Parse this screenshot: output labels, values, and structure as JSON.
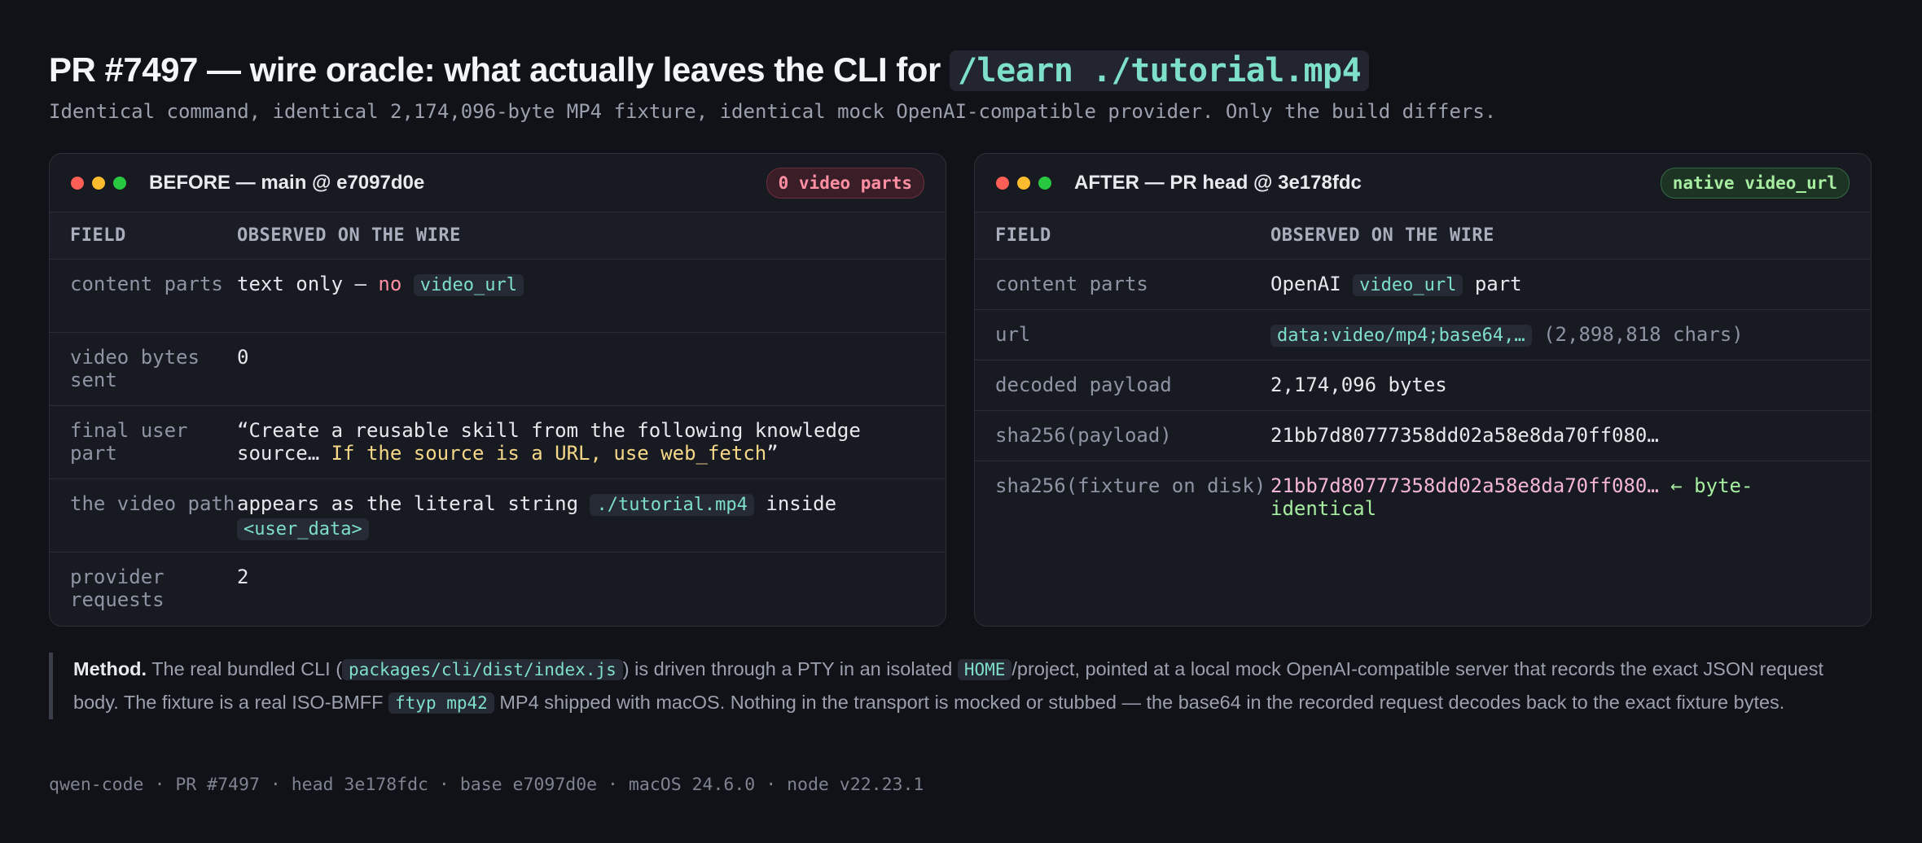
{
  "header": {
    "title_prefix": "PR #7497 — wire oracle: what actually leaves the CLI for",
    "title_code": "/learn ./tutorial.mp4",
    "subtitle": "Identical command, identical 2,174,096-byte MP4 fixture, identical mock OpenAI-compatible provider. Only the build differs."
  },
  "before": {
    "title": "BEFORE — main @ e7097d0e",
    "badge": "0 video parts",
    "col_field": "FIELD",
    "col_observed": "OBSERVED ON THE WIRE",
    "rows": [
      {
        "field": "content parts",
        "v_a": "text only —",
        "v_b": "no",
        "v_code": "video_url"
      },
      {
        "field": "video bytes sent",
        "value": "0"
      },
      {
        "field": "final user part",
        "v_a": "“Create a reusable skill from the following knowledge source…",
        "v_b": "If the source is a URL, use web_fetch",
        "v_c": "”"
      },
      {
        "field": "the video path",
        "v_a": "appears as the literal string",
        "v_code": "./tutorial.mp4",
        "v_b": "inside",
        "v_code2": "<user_data>"
      },
      {
        "field": "provider requests",
        "value": "2"
      }
    ]
  },
  "after": {
    "title": "AFTER — PR head @ 3e178fdc",
    "badge": "native video_url",
    "col_field": "FIELD",
    "col_observed": "OBSERVED ON THE WIRE",
    "rows": [
      {
        "field": "content parts",
        "v_a": "OpenAI",
        "v_code": "video_url",
        "v_b": "part"
      },
      {
        "field": "url",
        "v_code": "data:video/mp4;base64,…",
        "v_b": "(2,898,818 chars)"
      },
      {
        "field": "decoded payload",
        "value": "2,174,096 bytes"
      },
      {
        "field": "sha256(payload)",
        "value": "21bb7d80777358dd02a58e8da70ff080…"
      },
      {
        "field": "sha256(fixture on disk)",
        "value": "21bb7d80777358dd02a58e8da70ff080…",
        "note": "← byte-identical"
      }
    ]
  },
  "method": {
    "label": "Method.",
    "t1": "The real bundled CLI (",
    "c1": "packages/cli/dist/index.js",
    "t2": ") is driven through a PTY in an isolated",
    "c2": "HOME",
    "t3": "/project, pointed at a local mock OpenAI-compatible server that records the exact JSON request body. The fixture is a real ISO-BMFF",
    "c3": "ftyp mp42",
    "t4": "MP4 shipped with macOS. Nothing in the transport is mocked or stubbed — the base64 in the recorded request decodes back to the exact fixture bytes."
  },
  "footer": "qwen-code · PR #7497 · head 3e178fdc · base e7097d0e · macOS 24.6.0 · node v22.23.1",
  "colors": {
    "background": "#111217",
    "accent_code": "#7ee0c8",
    "bad": "#ff8fa3",
    "good": "#a6eda0",
    "highlight": "#f5d787"
  }
}
